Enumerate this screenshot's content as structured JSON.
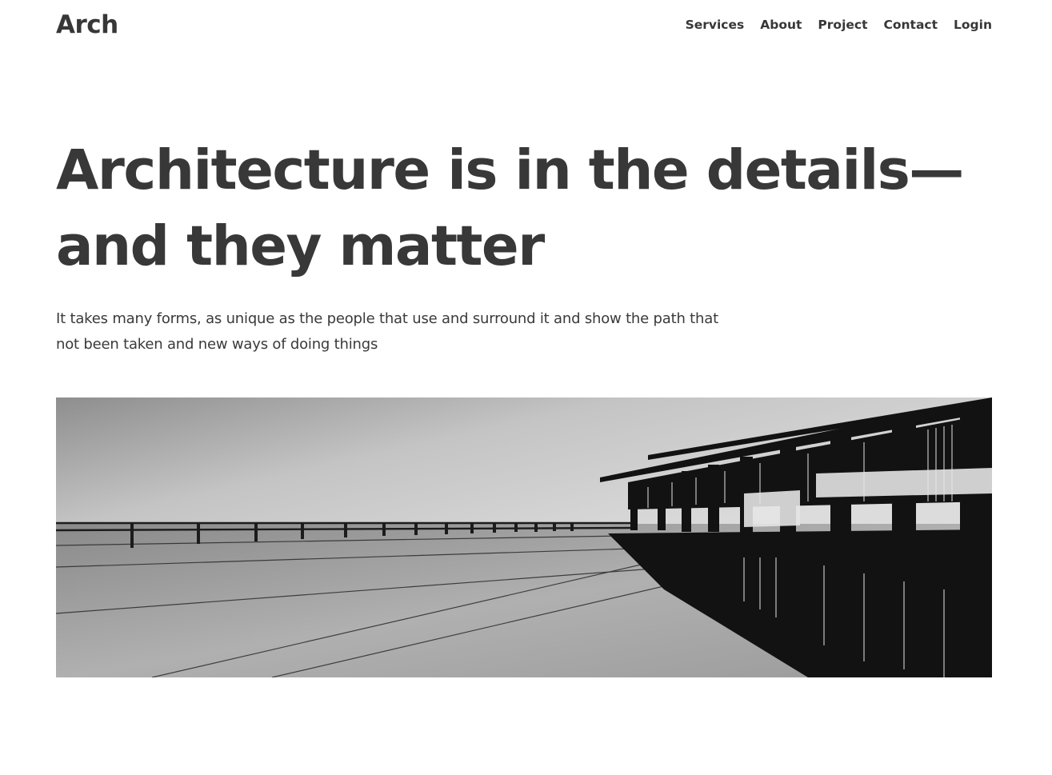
{
  "header": {
    "logo": "Arch",
    "nav": [
      {
        "label": "Services"
      },
      {
        "label": "About"
      },
      {
        "label": "Project"
      },
      {
        "label": "Contact"
      },
      {
        "label": "Login"
      }
    ]
  },
  "hero": {
    "headline": "Architecture is in the details—and they matter",
    "subtext": "It takes many forms, as unique as the people that use and surround it and show the path that not been taken and new ways of doing things",
    "image_description_icon": "building-photo"
  },
  "colors": {
    "text": "#373737",
    "background": "#ffffff"
  }
}
